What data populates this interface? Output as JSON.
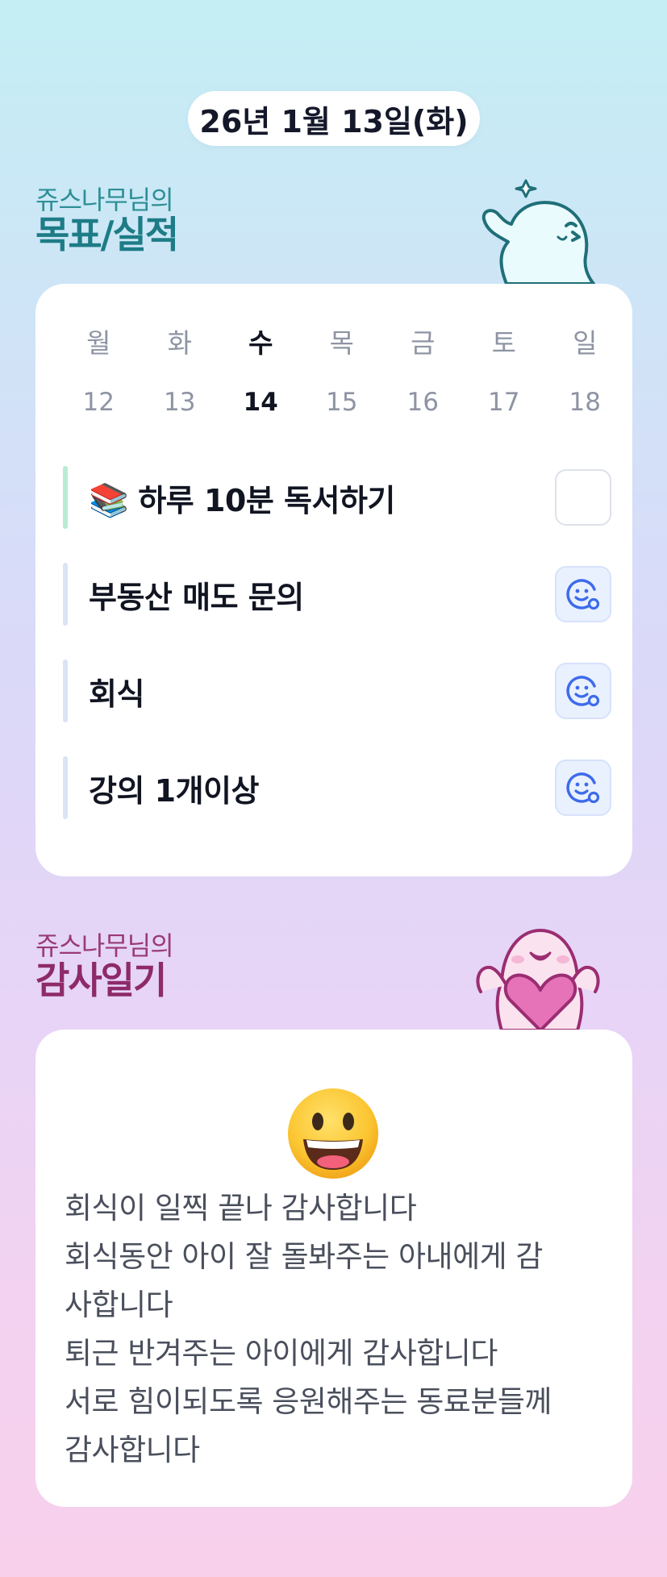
{
  "header": {
    "date": "26년 1월 13일(화)"
  },
  "goals_section": {
    "subtitle": "쥬스나무님의",
    "title": "목표/실적"
  },
  "week": {
    "days": [
      {
        "name": "월",
        "num": "12"
      },
      {
        "name": "화",
        "num": "13"
      },
      {
        "name": "수",
        "num": "14"
      },
      {
        "name": "목",
        "num": "15"
      },
      {
        "name": "금",
        "num": "16"
      },
      {
        "name": "토",
        "num": "17"
      },
      {
        "name": "일",
        "num": "18"
      }
    ],
    "active_index": 2
  },
  "tasks": [
    {
      "icon": "books-emoji",
      "emoji": "📚",
      "label": "하루 10분 독서하기",
      "status": "unchecked"
    },
    {
      "label": "부동산 매도 문의",
      "status": "smile"
    },
    {
      "label": "회식",
      "status": "smile"
    },
    {
      "label": "강의 1개이상",
      "status": "smile"
    }
  ],
  "gratitude_section": {
    "subtitle": "쥬스나무님의",
    "title": "감사일기",
    "mood_icon": "grinning-face-icon",
    "lines": [
      "회식이 일찍 끝나 감사합니다",
      "회식동안 아이 잘 돌봐주는 아내에게 감",
      "사합니다",
      "퇴근 반겨주는 아이에게 감사합니다",
      "서로 힘이되도록 응원해주는 동료분들께",
      "감사합니다"
    ]
  },
  "colors": {
    "goals_title": "#1d7c86",
    "gratitude_title": "#8e2a6a",
    "smile_icon": "#3d6bea",
    "active_day": "#111522"
  }
}
